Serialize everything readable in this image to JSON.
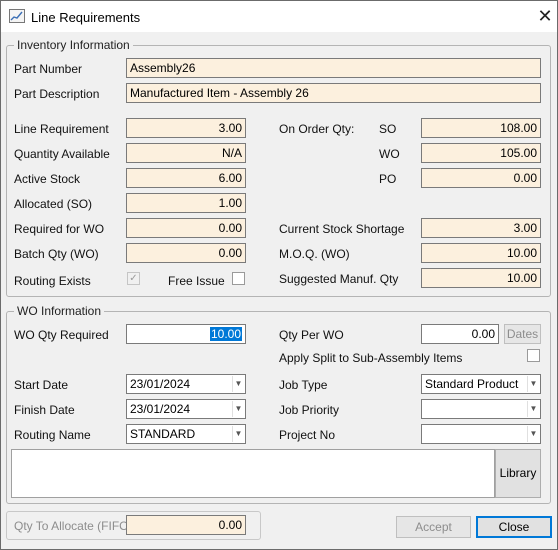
{
  "window": {
    "title": "Line Requirements",
    "close_glyph": "✕"
  },
  "inventory": {
    "group_label": "Inventory Information",
    "part_number_label": "Part Number",
    "part_number": "Assembly26",
    "part_description_label": "Part Description",
    "part_description": "Manufactured Item - Assembly 26",
    "line_requirement_label": "Line Requirement",
    "line_requirement": "3.00",
    "quantity_available_label": "Quantity Available",
    "quantity_available": "N/A",
    "active_stock_label": "Active Stock",
    "active_stock": "6.00",
    "allocated_so_label": "Allocated (SO)",
    "allocated_so": "1.00",
    "required_for_wo_label": "Required for WO",
    "required_for_wo": "0.00",
    "batch_qty_wo_label": "Batch Qty (WO)",
    "batch_qty_wo": "0.00",
    "routing_exists_label": "Routing Exists",
    "routing_exists_checked": true,
    "free_issue_label": "Free Issue",
    "free_issue_checked": false,
    "on_order_qty_label": "On Order Qty:",
    "so_label": "SO",
    "so_value": "108.00",
    "wo_label": "WO",
    "wo_value": "105.00",
    "po_label": "PO",
    "po_value": "0.00",
    "current_stock_shortage_label": "Current Stock Shortage",
    "current_stock_shortage": "3.00",
    "moq_wo_label": "M.O.Q. (WO)",
    "moq_wo": "10.00",
    "suggested_manuf_qty_label": "Suggested Manuf. Qty",
    "suggested_manuf_qty": "10.00"
  },
  "wo": {
    "group_label": "WO Information",
    "wo_qty_required_label": "WO Qty Required",
    "wo_qty_required": "10.00",
    "qty_per_wo_label": "Qty Per WO",
    "qty_per_wo": "0.00",
    "dates_button": "Dates",
    "apply_split_label": "Apply Split to Sub-Assembly Items",
    "apply_split_checked": false,
    "start_date_label": "Start Date",
    "start_date": "23/01/2024",
    "finish_date_label": "Finish Date",
    "finish_date": "23/01/2024",
    "routing_name_label": "Routing Name",
    "routing_name": "STANDARD",
    "job_type_label": "Job Type",
    "job_type": "Standard Product",
    "job_priority_label": "Job Priority",
    "job_priority": "",
    "project_no_label": "Project No",
    "project_no": "",
    "notes": "",
    "library_button": "Library"
  },
  "footer": {
    "qty_to_allocate_label": "Qty To Allocate (FIFO)",
    "qty_to_allocate": "0.00",
    "accept_button": "Accept",
    "close_button": "Close"
  },
  "icons": {
    "dropdown": "chevron-down-icon",
    "check": "check-icon"
  }
}
